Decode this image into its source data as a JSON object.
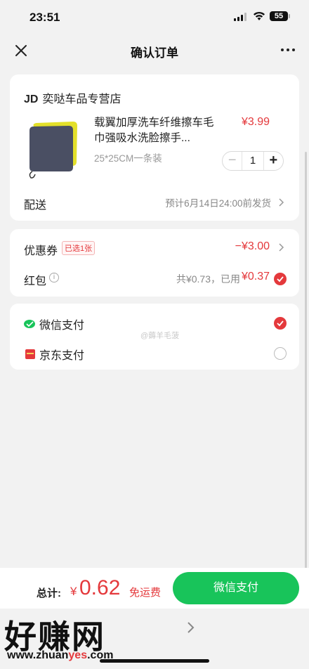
{
  "status_bar": {
    "time": "23:51",
    "battery": "55"
  },
  "nav": {
    "title": "确认订单"
  },
  "shop": {
    "brand": "JD",
    "name": "奕哒车品专营店"
  },
  "product": {
    "title": "载翼加厚洗车纤维擦车毛巾强吸水洗脸擦手...",
    "spec": "25*25CM一条装",
    "price": "¥3.99",
    "quantity": "1",
    "image_colors": {
      "front": "#4a4f63",
      "back": "#e3e02a"
    }
  },
  "delivery": {
    "label": "配送",
    "value": "预计6月14日24:00前发货"
  },
  "coupon": {
    "label": "优惠券",
    "badge": "已选1张",
    "value": "−¥3.00"
  },
  "red_packet": {
    "label": "红包",
    "total": "共¥0.73，已用",
    "used": "¥0.37",
    "checked": true
  },
  "payment_methods": [
    {
      "label": "微信支付",
      "icon": "wechat-pay-icon",
      "selected": true
    },
    {
      "label": "京东支付",
      "icon": "jd-pay-icon",
      "selected": false
    }
  ],
  "payment_watermark": "@薅羊毛菠",
  "bottom": {
    "total_label": "总计:",
    "currency": "¥",
    "amount": "0.62",
    "free_shipping": "免运费",
    "pay_button": "微信支付"
  },
  "site_watermark": {
    "logo": "好赚网",
    "url_prefix": "www.zhuan",
    "url_highlight": "yes",
    "url_suffix": ".com"
  },
  "colors": {
    "accent": "#e4393c",
    "pay_green": "#18c45a",
    "background": "#f2f2f2"
  }
}
